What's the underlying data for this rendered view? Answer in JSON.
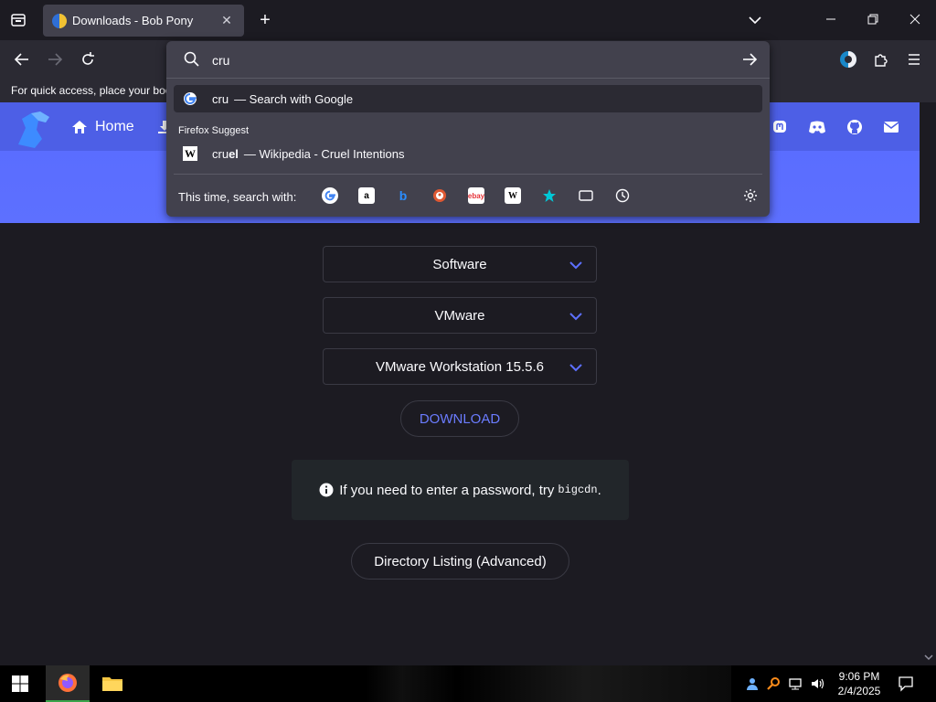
{
  "browser": {
    "tab_title": "Downloads - Bob Pony",
    "bookmarks_bar_text": "For quick access, place your bookmarks here on the bookmarks toolbar.",
    "url_input_value": "cru"
  },
  "url_dropdown": {
    "search_result": {
      "query": "cru",
      "suffix": "— Search with Google"
    },
    "suggest_label": "Firefox Suggest",
    "wiki_result": {
      "match_plain": "cru",
      "match_bold": "el",
      "suffix": "— Wikipedia - Cruel Intentions"
    },
    "one_off_label": "This time, search with:",
    "one_off_engines": [
      "google-icon",
      "amazon-icon",
      "bing-icon",
      "duckduckgo-icon",
      "ebay-icon",
      "wikipedia-icon",
      "bookmarks-icon",
      "tabs-icon",
      "history-icon"
    ]
  },
  "site": {
    "home_label": "Home"
  },
  "page": {
    "select_1": "Software",
    "select_2": "VMware",
    "select_3": "VMware Workstation 15.5.6",
    "download_label": "DOWNLOAD",
    "notice_text": "If you need to enter a password, try",
    "notice_code": "bigcdn",
    "notice_end": ".",
    "directory_label": "Directory Listing (Advanced)"
  },
  "taskbar": {
    "time": "9:06 PM",
    "date": "2/4/2025"
  },
  "colors": {
    "accent_blue": "#5d70ff",
    "link_blue": "#6b7cff",
    "browser_bg": "#1c1b22",
    "toolbar_bg": "#2b2a33",
    "panel_bg": "#42414d"
  }
}
